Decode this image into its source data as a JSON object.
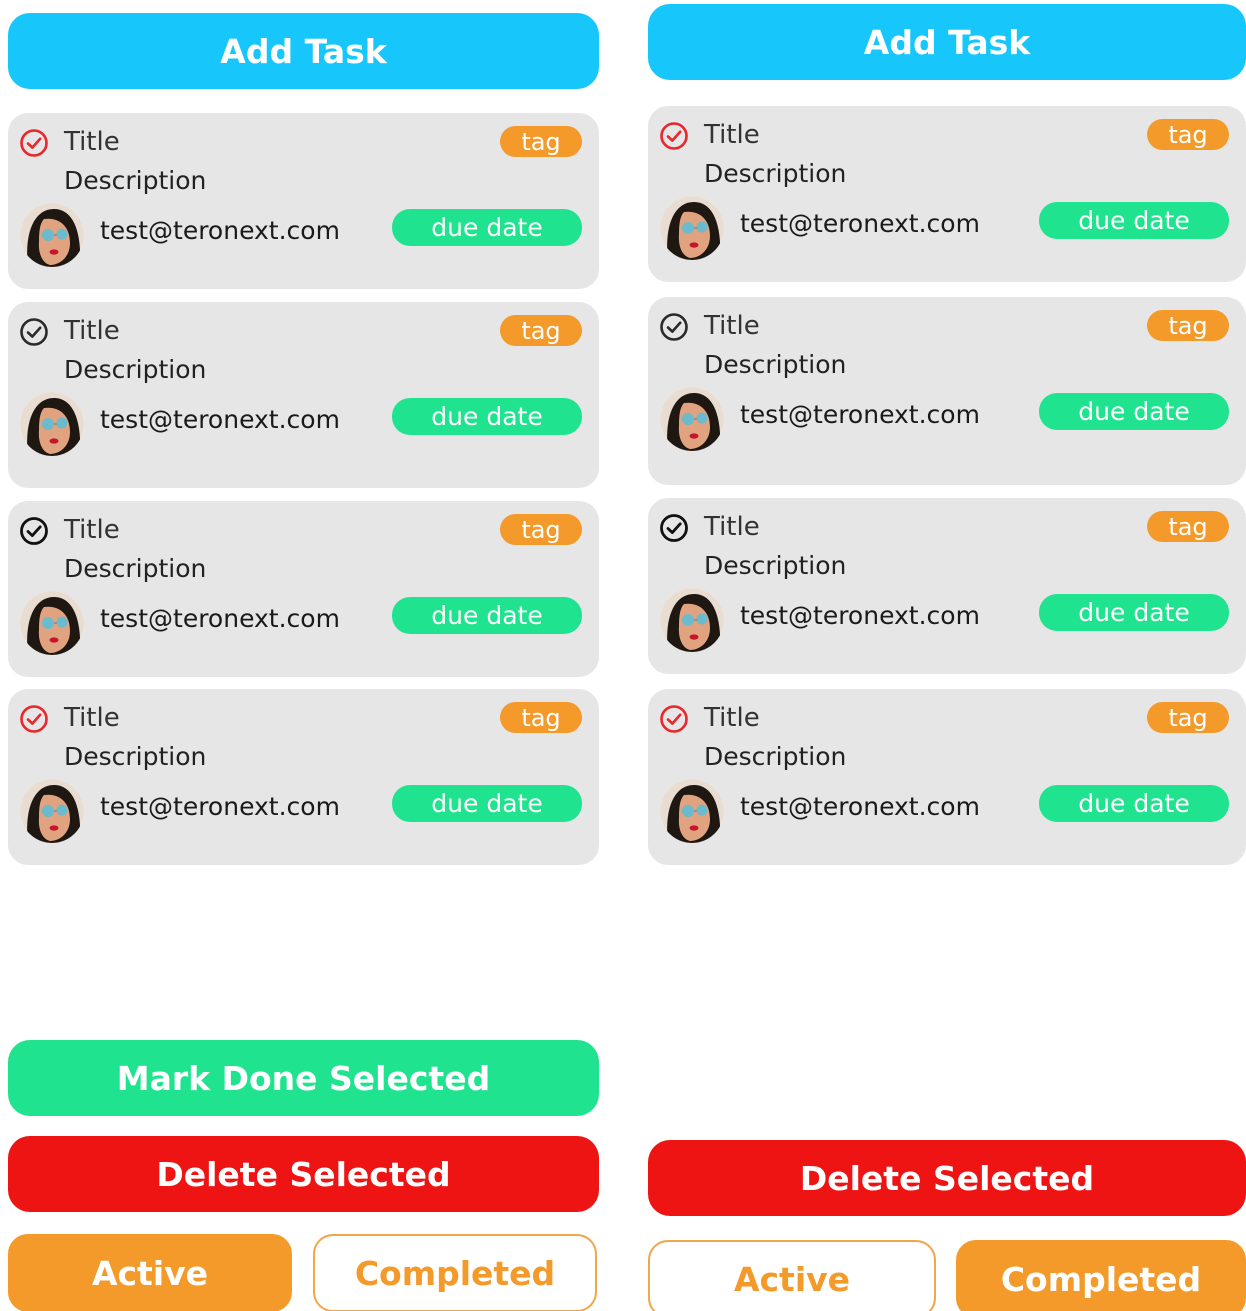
{
  "colors": {
    "add_task": "#17c6fb",
    "mark_done": "#20e38f",
    "delete": "#ee1414",
    "tag": "#f39a2a",
    "due_date": "#20e38f",
    "card_bg": "#e6e6e6",
    "check_red": "#e8262b",
    "check_dark": "#2a2a2a"
  },
  "left": {
    "add_task_label": "Add Task",
    "tasks": [
      {
        "title": "Title",
        "description": "Description",
        "email": "test@teronext.com",
        "tag": "tag",
        "due": "due date",
        "check_icon": "check-circle-red-icon"
      },
      {
        "title": "Title",
        "description": "Description",
        "email": "test@teronext.com",
        "tag": "tag",
        "due": "due date",
        "check_icon": "check-circle-dark-icon"
      },
      {
        "title": "Title",
        "description": "Description",
        "email": "test@teronext.com",
        "tag": "tag",
        "due": "due date",
        "check_icon": "check-circle-dark-icon"
      },
      {
        "title": "Title",
        "description": "Description",
        "email": "test@teronext.com",
        "tag": "tag",
        "due": "due date",
        "check_icon": "check-circle-red-icon"
      }
    ],
    "mark_done_label": "Mark Done Selected",
    "delete_label": "Delete Selected",
    "filter_active": "Active",
    "filter_completed": "Completed",
    "selected_filter": "Active"
  },
  "right": {
    "add_task_label": "Add Task",
    "tasks": [
      {
        "title": "Title",
        "description": "Description",
        "email": "test@teronext.com",
        "tag": "tag",
        "due": "due date",
        "check_icon": "check-circle-red-icon"
      },
      {
        "title": "Title",
        "description": "Description",
        "email": "test@teronext.com",
        "tag": "tag",
        "due": "due date",
        "check_icon": "check-circle-dark-icon"
      },
      {
        "title": "Title",
        "description": "Description",
        "email": "test@teronext.com",
        "tag": "tag",
        "due": "due date",
        "check_icon": "check-circle-dark-icon"
      },
      {
        "title": "Title",
        "description": "Description",
        "email": "test@teronext.com",
        "tag": "tag",
        "due": "due date",
        "check_icon": "check-circle-red-icon"
      }
    ],
    "delete_label": "Delete Selected",
    "filter_active": "Active",
    "filter_completed": "Completed",
    "selected_filter": "Completed"
  }
}
